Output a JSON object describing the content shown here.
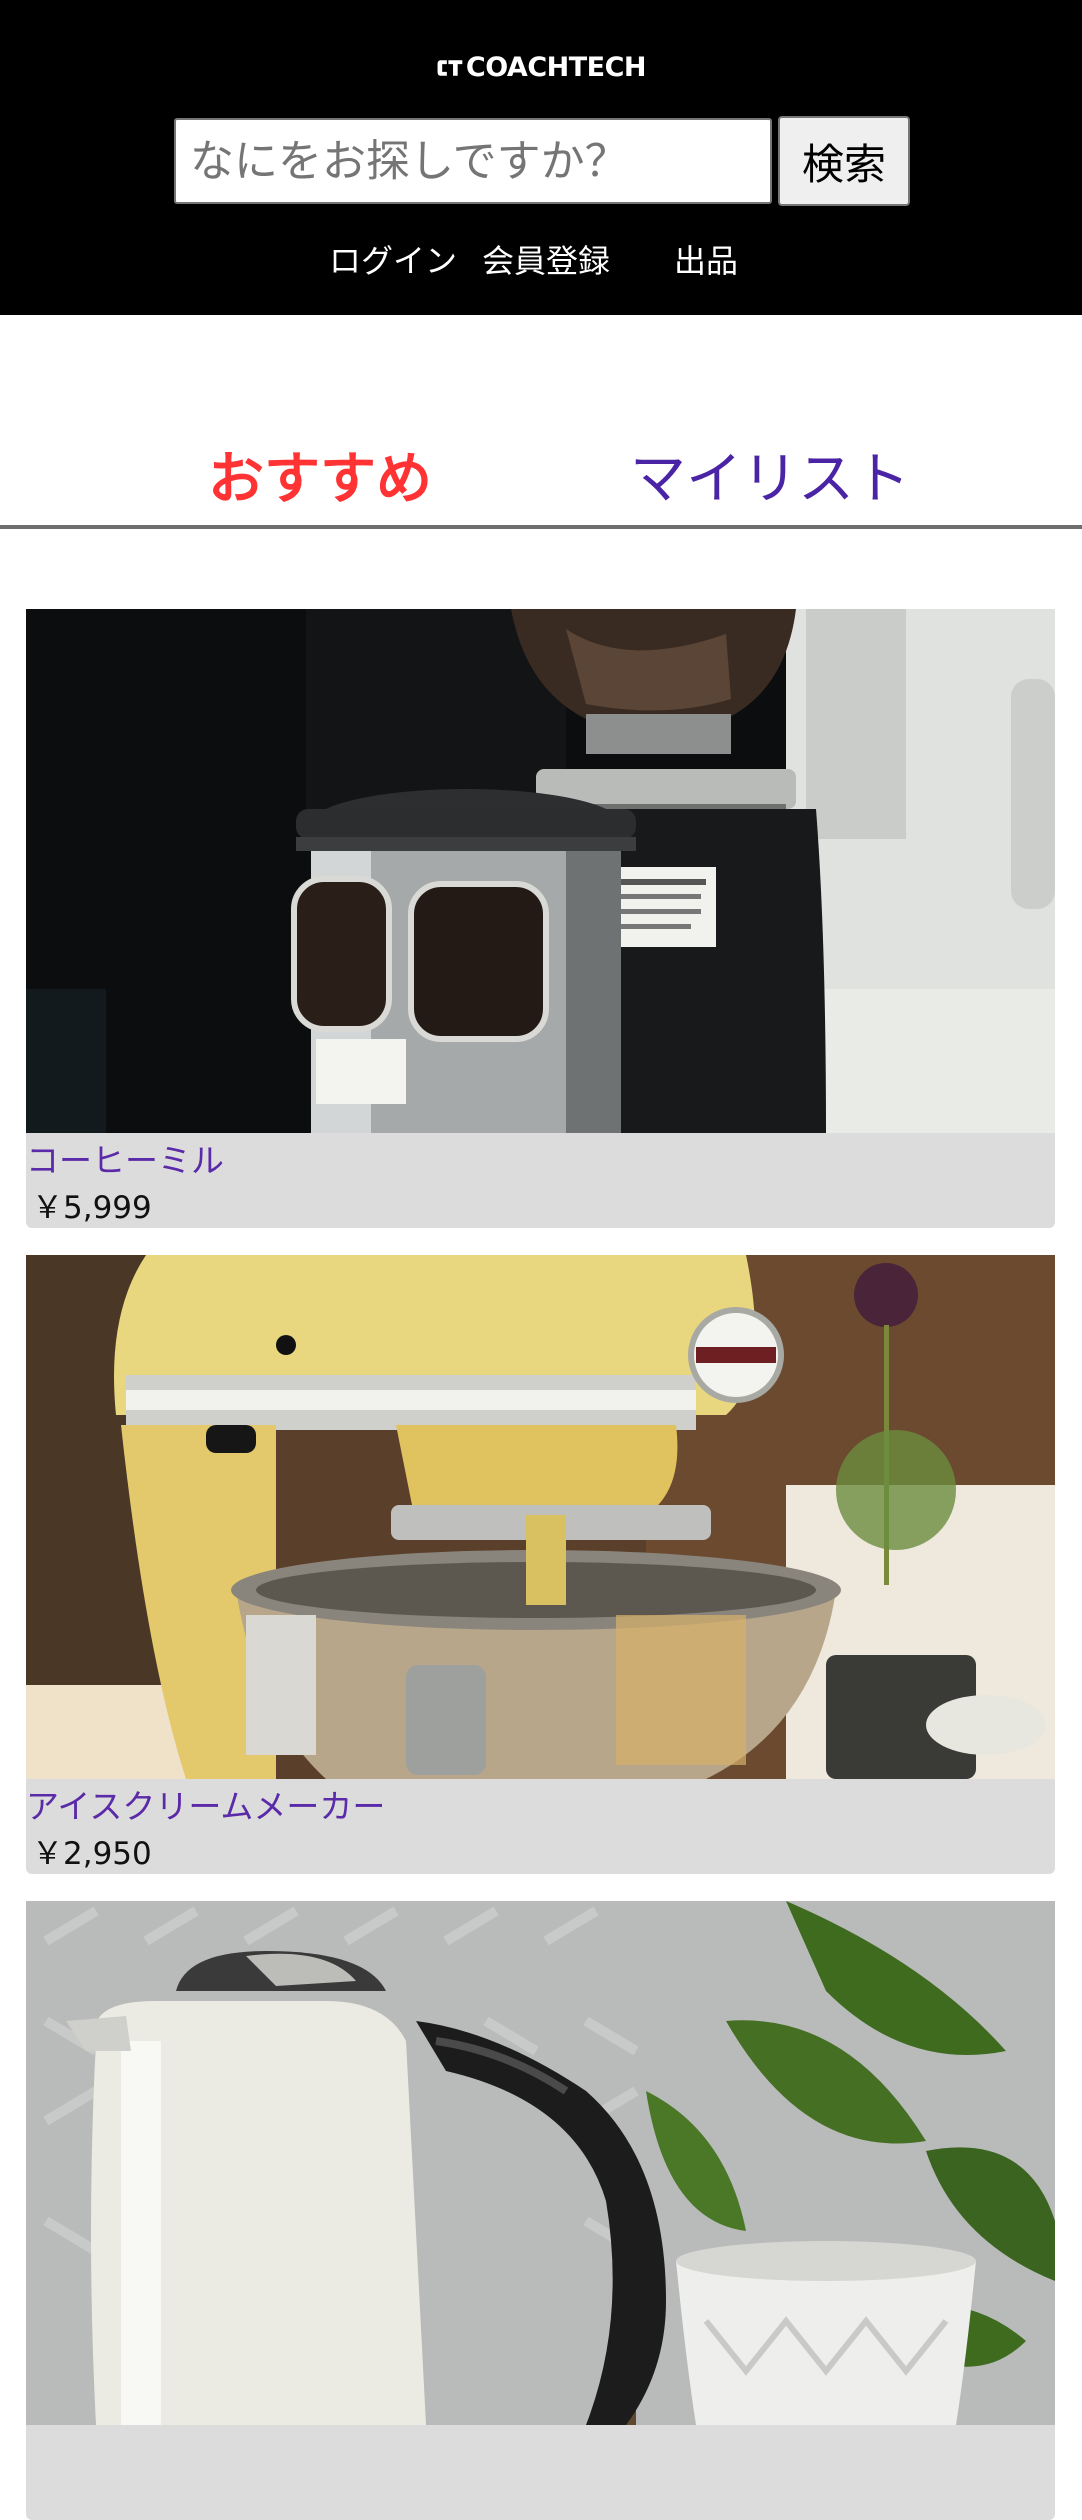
{
  "header": {
    "logo_text": "COACHTECH",
    "search": {
      "placeholder": "なにをお探しですか？",
      "value": ""
    },
    "search_button": "検索",
    "nav": {
      "login": "ログイン",
      "register": "会員登録",
      "sell": "出品"
    }
  },
  "tabs": [
    {
      "label": "おすすめ",
      "active": true,
      "color": "#ff3333"
    },
    {
      "label": "マイリスト",
      "active": false,
      "color": "#4b24a6"
    }
  ],
  "products": [
    {
      "name": "コーヒーミル",
      "price": "￥5,999",
      "image": "coffee-grinder"
    },
    {
      "name": "アイスクリームメーカー",
      "price": "￥2,950",
      "image": "stand-mixer"
    },
    {
      "name": "",
      "price": "",
      "image": "electric-kettle"
    }
  ],
  "colors": {
    "header_bg": "#000000",
    "card_bg": "#dcdcdc",
    "link": "#5a2aa8",
    "accent": "#ff3333"
  }
}
